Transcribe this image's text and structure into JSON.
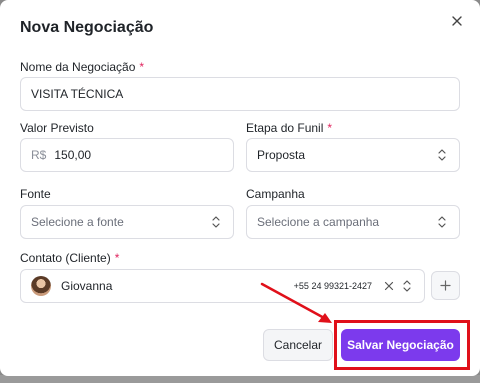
{
  "modal": {
    "title": "Nova Negociação"
  },
  "form": {
    "name": {
      "label": "Nome da Negociação",
      "required_mark": "*",
      "value": "VISITA TÉCNICA"
    },
    "value": {
      "label": "Valor Previsto",
      "currency": "R$",
      "value": "150,00"
    },
    "stage": {
      "label": "Etapa do Funil",
      "required_mark": "*",
      "value": "Proposta"
    },
    "source": {
      "label": "Fonte",
      "placeholder": "Selecione a fonte"
    },
    "campaign": {
      "label": "Campanha",
      "placeholder": "Selecione a campanha"
    },
    "contact": {
      "label": "Contato (Cliente)",
      "required_mark": "*",
      "name": "Giovanna",
      "phone": "+55 24 99321-2427"
    }
  },
  "actions": {
    "cancel_label": "Cancelar",
    "save_label": "Salvar Negociação"
  },
  "colors": {
    "accent": "#7c3aed",
    "required": "#e0245e",
    "annotation": "#e0101a"
  },
  "icons": {
    "close": "close-icon",
    "select": "chevron-updown-icon",
    "clear": "clear-icon",
    "add": "plus-icon"
  }
}
